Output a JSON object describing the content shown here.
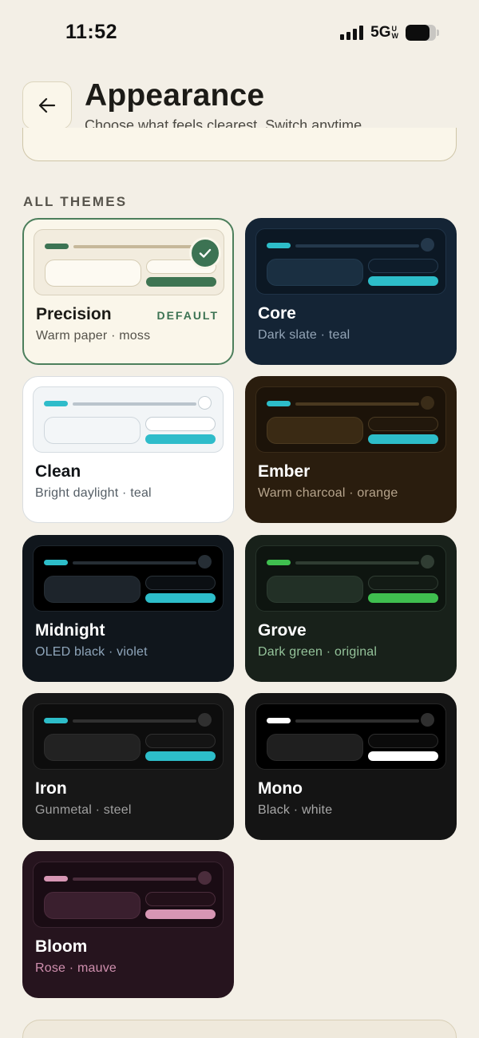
{
  "status_bar": {
    "time": "11:52",
    "network": "5G",
    "network_sup_top": "U",
    "network_sup_bottom": "W",
    "battery_level": 0.8
  },
  "header": {
    "title": "Appearance",
    "subtitle": "Choose what feels clearest. Switch anytime."
  },
  "section_label": "ALL THEMES",
  "themes": [
    {
      "name": "Precision",
      "description": "Warm paper · moss",
      "badge": "DEFAULT",
      "selected": true,
      "colors": {
        "card_bg": "#faf6ea",
        "card_border": "#4c7f5c",
        "name": "#1c1b17",
        "desc": "#55524a",
        "preview_bg": "#f2ecde",
        "preview_border": "#d9d1bd",
        "bar": "#3c7353",
        "line": "#c6b89a",
        "dot": "#3c7353",
        "block": "#fdfaf2",
        "block_border": "#d6cdb5",
        "small": "#fdfaf2",
        "small_border": "#d6cdb5",
        "accent": "#3e7452"
      }
    },
    {
      "name": "Core",
      "description": "Dark slate · teal",
      "selected": false,
      "colors": {
        "card_bg": "#142435",
        "card_border": "#142435",
        "name": "#ffffff",
        "desc": "#93a4b6",
        "preview_bg": "#0c1824",
        "preview_border": "#1f3347",
        "bar": "#2dbdc9",
        "line": "#24384b",
        "dot": "#24384b",
        "block": "#1a2f41",
        "block_border": "#223a4f",
        "small": "#0e1c2a",
        "small_border": "#263c51",
        "accent": "#2dbdc9"
      }
    },
    {
      "name": "Clean",
      "description": "Bright daylight · teal",
      "selected": false,
      "colors": {
        "card_bg": "#ffffff",
        "card_border": "#d9dde0",
        "name": "#111418",
        "desc": "#555e66",
        "preview_bg": "#f2f5f7",
        "preview_border": "#d5dce1",
        "bar": "#2fbcca",
        "line": "#bac4cc",
        "dot": "#ffffff",
        "block": "#f3f6f8",
        "block_border": "#cfd7dd",
        "small": "#ffffff",
        "small_border": "#c5ced4",
        "accent": "#2fbcca"
      }
    },
    {
      "name": "Ember",
      "description": "Warm charcoal · orange",
      "selected": false,
      "colors": {
        "card_bg": "#2a1d0e",
        "card_border": "#2a1d0e",
        "name": "#ffffff",
        "desc": "#b6a48c",
        "preview_bg": "#1c1309",
        "preview_border": "#3a2b18",
        "bar": "#2dbdc9",
        "line": "#4a3920",
        "dot": "#3a2c18",
        "block": "#3a2a14",
        "block_border": "#4b3a20",
        "small": "#22180c",
        "small_border": "#4a3a22",
        "accent": "#2dbdc9"
      }
    },
    {
      "name": "Midnight",
      "description": "OLED black · violet",
      "selected": false,
      "colors": {
        "card_bg": "#10161c",
        "card_border": "#10161c",
        "name": "#ffffff",
        "desc": "#8fa6bb",
        "preview_bg": "#000000",
        "preview_border": "#1e262d",
        "bar": "#2dbdc9",
        "line": "#262e35",
        "dot": "#262e35",
        "block": "#1d242b",
        "block_border": "#262e35",
        "small": "#0b0f13",
        "small_border": "#2a3239",
        "accent": "#2dbdc9"
      }
    },
    {
      "name": "Grove",
      "description": "Dark green · original",
      "selected": false,
      "colors": {
        "card_bg": "#18211a",
        "card_border": "#18211a",
        "name": "#ffffff",
        "desc": "#94c39a",
        "preview_bg": "#0e1510",
        "preview_border": "#26332a",
        "bar": "#3fbf4f",
        "line": "#303d33",
        "dot": "#303d33",
        "block": "#223026",
        "block_border": "#2c3b30",
        "small": "#131b15",
        "small_border": "#303d33",
        "accent": "#3fbf4f"
      }
    },
    {
      "name": "Iron",
      "description": "Gunmetal · steel",
      "selected": false,
      "colors": {
        "card_bg": "#171717",
        "card_border": "#171717",
        "name": "#ffffff",
        "desc": "#a0a0a0",
        "preview_bg": "#0d0d0d",
        "preview_border": "#262626",
        "bar": "#2dbdc9",
        "line": "#303030",
        "dot": "#303030",
        "block": "#222222",
        "block_border": "#2c2c2c",
        "small": "#141414",
        "small_border": "#303030",
        "accent": "#2dbdc9"
      }
    },
    {
      "name": "Mono",
      "description": "Black · white",
      "selected": false,
      "colors": {
        "card_bg": "#141414",
        "card_border": "#141414",
        "name": "#ffffff",
        "desc": "#a8a8a8",
        "preview_bg": "#000000",
        "preview_border": "#262626",
        "bar": "#ffffff",
        "line": "#2f2f2f",
        "dot": "#2f2f2f",
        "block": "#1f1f1f",
        "block_border": "#2a2a2a",
        "small": "#0b0b0b",
        "small_border": "#2e2e2e",
        "accent": "#ffffff"
      }
    },
    {
      "name": "Bloom",
      "description": "Rose · mauve",
      "selected": false,
      "colors": {
        "card_bg": "#26141e",
        "card_border": "#26141e",
        "name": "#ffffff",
        "desc": "#cf8fae",
        "preview_bg": "#1a0c14",
        "preview_border": "#3a2430",
        "bar": "#d796b4",
        "line": "#4b2d3c",
        "dot": "#4b2d3c",
        "block": "#3a1f2e",
        "block_border": "#4b2b3c",
        "small": "#221019",
        "small_border": "#4b2d3c",
        "accent": "#d796b4"
      }
    }
  ]
}
